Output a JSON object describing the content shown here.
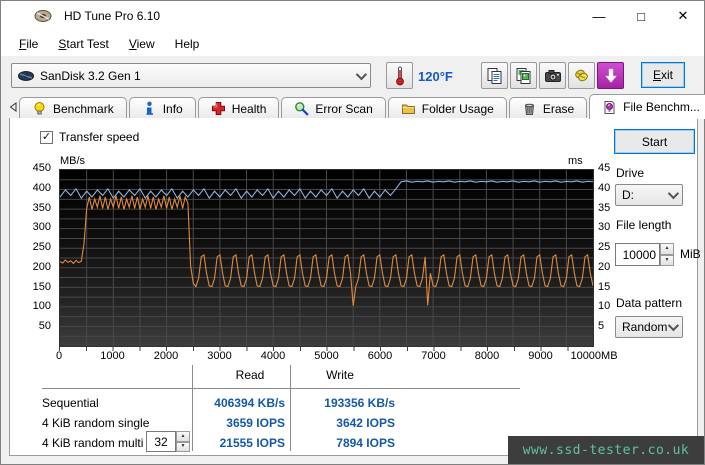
{
  "window": {
    "title": "HD Tune Pro 6.10",
    "controls": {
      "minimize": "—",
      "maximize": "□",
      "close": "✕"
    }
  },
  "menu": {
    "items": [
      {
        "label": "File"
      },
      {
        "label": "Start Test"
      },
      {
        "label": "View"
      },
      {
        "label": "Help"
      }
    ]
  },
  "toolbar": {
    "drive_value": "SanDisk 3.2 Gen 1",
    "temperature": "120°F",
    "icons": [
      "thermometer-icon",
      "copy-text-icon",
      "copy-image-icon",
      "screenshot-icon",
      "donate-icon",
      "download-icon"
    ],
    "exit_label": "Exit"
  },
  "tabs": {
    "items": [
      {
        "label": "Benchmark",
        "icon": "bulb-icon"
      },
      {
        "label": "Info",
        "icon": "info-icon"
      },
      {
        "label": "Health",
        "icon": "health-cross-icon"
      },
      {
        "label": "Error Scan",
        "icon": "magnifier-icon"
      },
      {
        "label": "Folder Usage",
        "icon": "folder-icon"
      },
      {
        "label": "Erase",
        "icon": "trash-icon"
      },
      {
        "label": "File Benchm...",
        "icon": "file-bulb-icon",
        "active": true
      }
    ]
  },
  "fb": {
    "transfer_speed_label": "Transfer speed",
    "start_label": "Start",
    "drive_label": "Drive",
    "drive_value": "D:",
    "file_length_label": "File length",
    "file_length_value": "10000",
    "file_length_unit": "MiB",
    "data_pattern_label": "Data pattern",
    "data_pattern_value": "Random"
  },
  "results": {
    "columns": [
      "Read",
      "Write"
    ],
    "rows": [
      {
        "label": "Sequential",
        "read": "406394 KB/s",
        "write": "193356 KB/s"
      },
      {
        "label": "4 KiB random single",
        "read": "3659 IOPS",
        "write": "3642 IOPS"
      },
      {
        "label": "4 KiB random multi",
        "queue_depth": "32",
        "read": "21555 IOPS",
        "write": "7894 IOPS"
      }
    ]
  },
  "watermark": "www.ssd-tester.co.uk",
  "chart_data": {
    "type": "line",
    "title": "File benchmark transfer speed over file position",
    "xlim": [
      0,
      10000
    ],
    "x_unit": "MB",
    "grid": {
      "x_step": 500,
      "y_step": 25
    },
    "y_left": {
      "label": "MB/s",
      "min": 0,
      "max": 450,
      "ticks": [
        450,
        400,
        350,
        300,
        250,
        200,
        150,
        100,
        50
      ]
    },
    "y_right": {
      "label": "ms",
      "min": 0,
      "max": 45,
      "ticks": [
        45,
        40,
        35,
        30,
        25,
        20,
        15,
        10,
        5
      ]
    },
    "x_ticks": [
      "0",
      "1000",
      "2000",
      "3000",
      "4000",
      "5000",
      "6000",
      "7000",
      "8000",
      "9000",
      "10000MB"
    ],
    "legend": "none",
    "series": [
      {
        "name": "read-speed",
        "color": "#8fb2e0",
        "axis": "left",
        "x_start": 0,
        "x_step": 100,
        "values": [
          381,
          399,
          385,
          402,
          378,
          396,
          381,
          399,
          385,
          402,
          378,
          396,
          381,
          399,
          385,
          402,
          378,
          396,
          381,
          399,
          385,
          402,
          378,
          396,
          381,
          399,
          385,
          402,
          378,
          396,
          381,
          399,
          385,
          402,
          378,
          396,
          381,
          399,
          385,
          402,
          378,
          396,
          381,
          399,
          385,
          402,
          378,
          396,
          381,
          399,
          385,
          402,
          378,
          396,
          381,
          399,
          385,
          402,
          378,
          396,
          381,
          399,
          385,
          402,
          420,
          422,
          419,
          421,
          420,
          422,
          419,
          421,
          420,
          422,
          419,
          421,
          420,
          422,
          419,
          421,
          420,
          422,
          419,
          421,
          420,
          422,
          419,
          421,
          420,
          422,
          419,
          421,
          420,
          422,
          419,
          421,
          420,
          422,
          419,
          421,
          420
        ]
      },
      {
        "name": "write-speed",
        "color": "#e08a3c",
        "axis": "left",
        "x_start": 0,
        "x_step": 50,
        "values": [
          216,
          212,
          220,
          214,
          218,
          211,
          219,
          213,
          217,
          262,
          352,
          381,
          349,
          376,
          355,
          384,
          352,
          381,
          349,
          376,
          355,
          384,
          352,
          381,
          349,
          376,
          355,
          384,
          352,
          381,
          349,
          376,
          355,
          384,
          352,
          381,
          349,
          376,
          355,
          384,
          352,
          381,
          349,
          376,
          355,
          384,
          352,
          381,
          365,
          205,
          160,
          152,
          173,
          228,
          233,
          186,
          154,
          152,
          173,
          228,
          233,
          186,
          154,
          152,
          173,
          228,
          233,
          186,
          154,
          152,
          173,
          228,
          233,
          186,
          154,
          152,
          173,
          228,
          233,
          186,
          154,
          152,
          173,
          228,
          233,
          186,
          154,
          152,
          173,
          228,
          233,
          186,
          154,
          152,
          173,
          228,
          233,
          186,
          154,
          152,
          173,
          228,
          233,
          186,
          154,
          152,
          173,
          228,
          233,
          186,
          103,
          152,
          173,
          228,
          233,
          186,
          154,
          152,
          173,
          228,
          233,
          186,
          154,
          152,
          173,
          228,
          233,
          186,
          154,
          152,
          173,
          228,
          233,
          186,
          154,
          152,
          173,
          228,
          104,
          186,
          154,
          152,
          173,
          228,
          233,
          186,
          154,
          152,
          173,
          228,
          233,
          186,
          154,
          152,
          173,
          228,
          233,
          186,
          154,
          152,
          173,
          228,
          233,
          186,
          154,
          152,
          173,
          228,
          233,
          186,
          154,
          152,
          173,
          228,
          233,
          186,
          154,
          152,
          173,
          228,
          233,
          186,
          154,
          152,
          173,
          228,
          233,
          186,
          154,
          152,
          173,
          228,
          233,
          186,
          154,
          152,
          173,
          228,
          233,
          186,
          154
        ]
      }
    ]
  }
}
